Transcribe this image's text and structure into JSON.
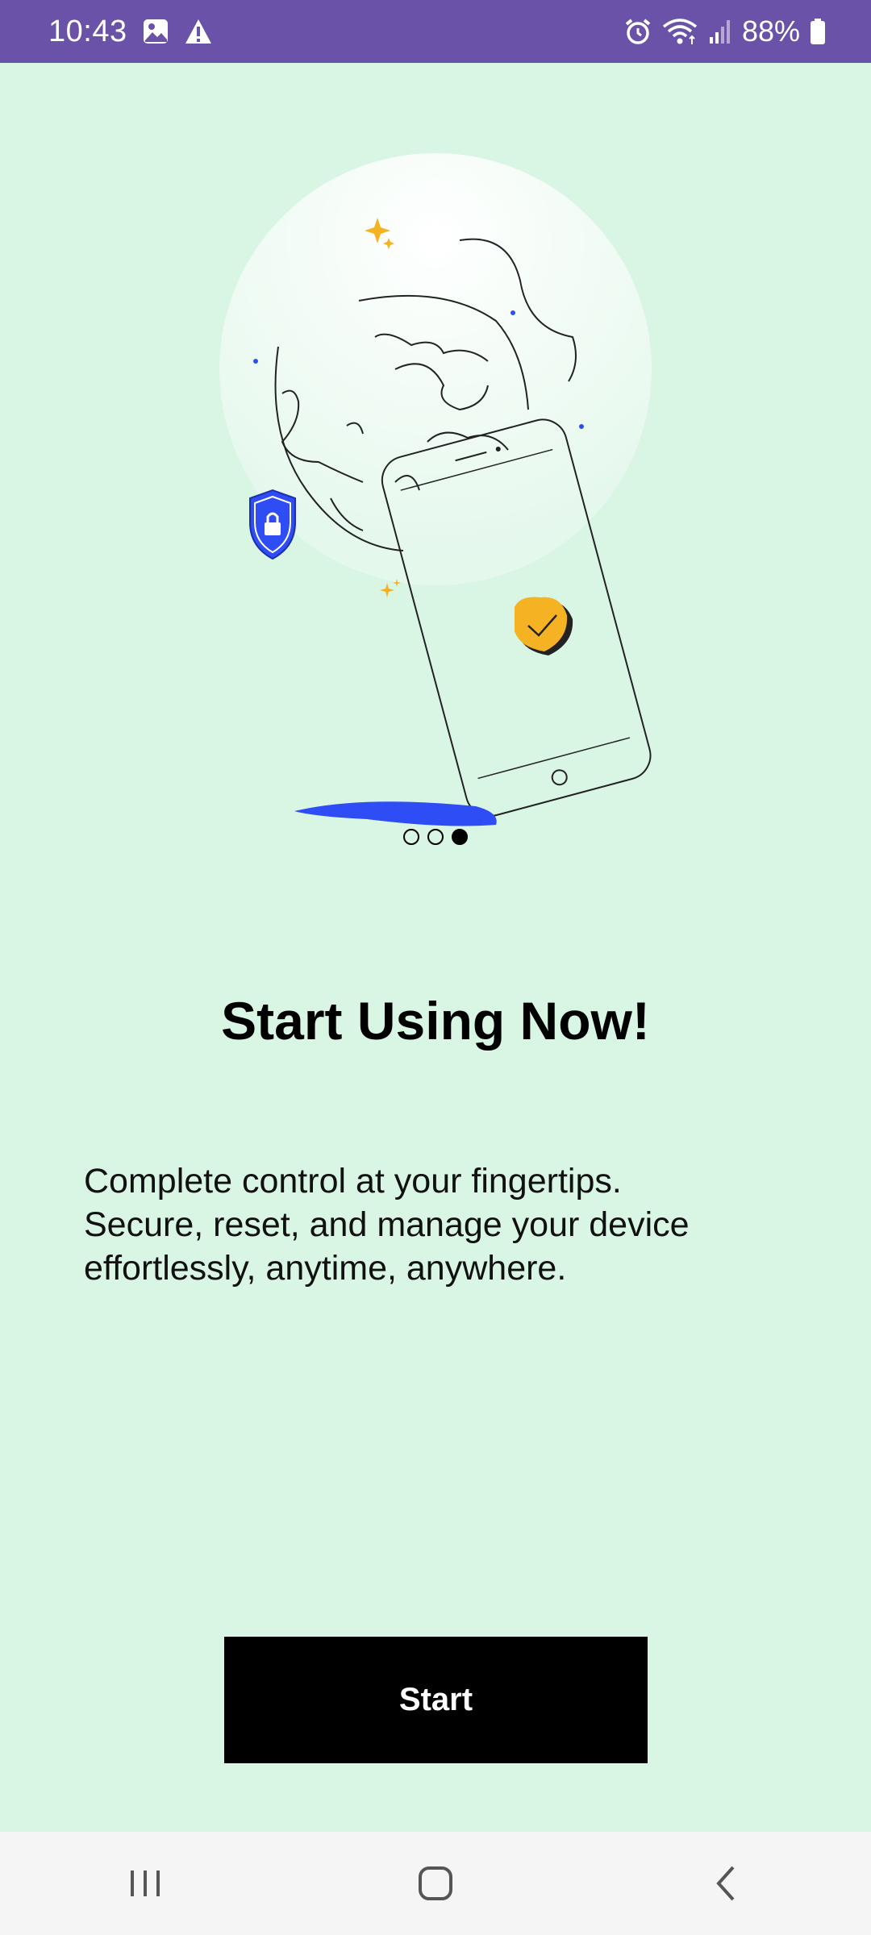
{
  "status_bar": {
    "time": "10:43",
    "battery": "88%",
    "icons": [
      "image-icon",
      "warning-icon",
      "alarm-icon",
      "wifi-icon",
      "signal-icon",
      "battery-icon"
    ],
    "background": "#6a52a8"
  },
  "onboarding": {
    "page_indicator": {
      "total": 3,
      "active_index": 2
    },
    "title": "Start Using Now!",
    "description_lines": [
      "Complete control at your fingertips.",
      "Secure, reset, and manage your device",
      "effortlessly, anytime, anywhere."
    ],
    "start_button_label": "Start",
    "background": "#d9f5e4",
    "accent_blue": "#2f4df5",
    "accent_yellow": "#f5b324"
  },
  "nav_bar": {
    "icons": [
      "recent-apps-icon",
      "home-icon",
      "back-icon"
    ]
  }
}
